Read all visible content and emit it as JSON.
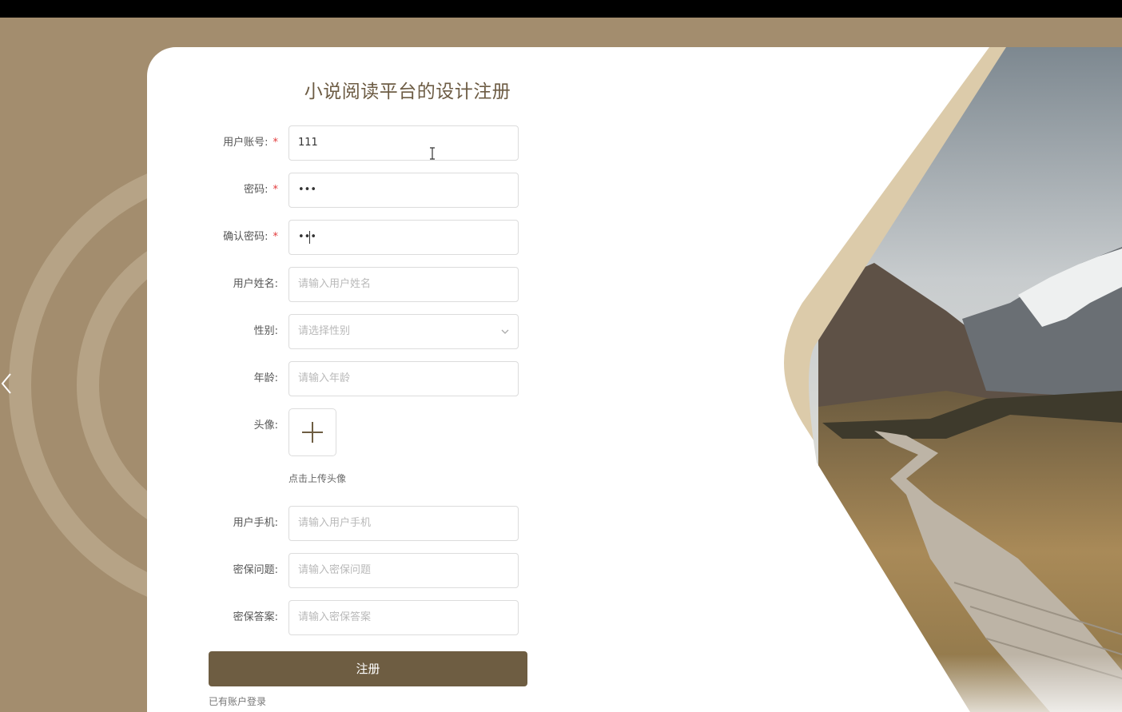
{
  "form": {
    "title": "小说阅读平台的设计注册",
    "fields": {
      "account": {
        "label": "用户账号:",
        "required": "*",
        "value": "111"
      },
      "password": {
        "label": "密码:",
        "required": "*",
        "value": "•••"
      },
      "confirm": {
        "label": "确认密码:",
        "required": "*",
        "value": "•••"
      },
      "name": {
        "label": "用户姓名:",
        "placeholder": "请输入用户姓名"
      },
      "gender": {
        "label": "性别:",
        "placeholder": "请选择性别"
      },
      "age": {
        "label": "年龄:",
        "placeholder": "请输入年龄"
      },
      "avatar": {
        "label": "头像:",
        "hint": "点击上传头像"
      },
      "phone": {
        "label": "用户手机:",
        "placeholder": "请输入用户手机"
      },
      "question": {
        "label": "密保问题:",
        "placeholder": "请输入密保问题"
      },
      "answer": {
        "label": "密保答案:",
        "placeholder": "请输入密保答案"
      }
    },
    "register_button": "注册",
    "login_link": "已有账户登录"
  },
  "icons": {
    "carousel_prev": "chevron-left-icon",
    "select_arrow": "chevron-down-icon",
    "upload": "plus-icon",
    "cursor": "text-cursor-icon"
  },
  "colors": {
    "page_background": "#a38d6e",
    "accent": "#6e5d42",
    "frame": "#dccbaa",
    "required": "#e2393b"
  }
}
